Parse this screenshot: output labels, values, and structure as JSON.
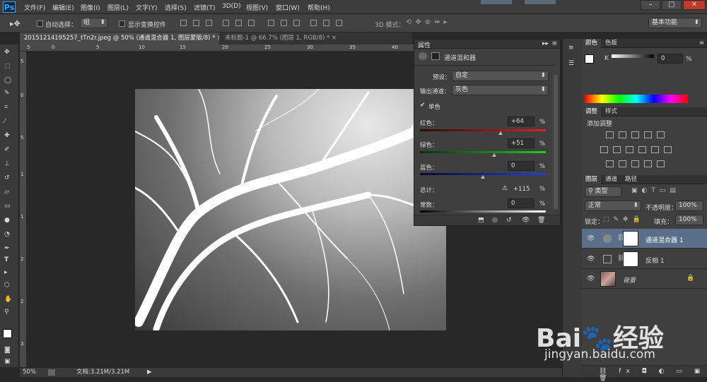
{
  "menubar": {
    "logo": "Ps",
    "items": [
      "文件(F)",
      "编辑(E)",
      "图像(I)",
      "图层(L)",
      "文字(Y)",
      "选择(S)",
      "滤镜(T)",
      "3D(D)",
      "视图(V)",
      "窗口(W)",
      "帮助(H)"
    ],
    "win_min": "–",
    "win_max": "□",
    "win_close": "✕"
  },
  "options": {
    "auto_select_label": "自动选择：",
    "auto_select_value": "组",
    "show_transform_label": "显示变换控件",
    "mode3d_label": "3D 模式：",
    "workspace": "基本功能"
  },
  "tabs": [
    {
      "label": "20151214195257_tTn2r.jpeg @ 50% (通道混合器 1, 图层蒙版/8) *",
      "close": "×"
    },
    {
      "label": "未标题-1 @ 66.7% (图层 1, RGB/8) *",
      "close": "×"
    }
  ],
  "ruler_h": [
    "5",
    "0",
    "5",
    "10",
    "15",
    "20",
    "25",
    "30",
    "35",
    "40"
  ],
  "ruler_v": [
    "5",
    "0",
    "5",
    "1",
    "1",
    "2",
    "2",
    "3"
  ],
  "status": {
    "zoom": "50%",
    "doc": "文档:3.21M/3.21M"
  },
  "properties": {
    "title": "属性",
    "panel_name": "通道混和器",
    "preset_label": "预设：",
    "preset_value": "自定",
    "output_label": "输出通道：",
    "output_value": "灰色",
    "mono_label": "单色",
    "red_label": "红色：",
    "red_value": "+64",
    "green_label": "绿色：",
    "green_value": "+51",
    "blue_label": "蓝色：",
    "blue_value": "0",
    "total_label": "总计：",
    "total_value": "+115",
    "const_label": "常数：",
    "const_value": "0",
    "percent": "%",
    "warn": "⚠",
    "red_pos": 0.64,
    "green_pos": 0.59,
    "blue_pos": 0.5
  },
  "color_panel": {
    "tabs": [
      "颜色",
      "色板"
    ],
    "label": "K",
    "value": "0",
    "percent": "%"
  },
  "adjust_panel": {
    "tabs": [
      "调整",
      "样式"
    ],
    "title": "添加调整"
  },
  "layers_panel": {
    "tabs": [
      "图层",
      "通道",
      "路径"
    ],
    "filter": "类型",
    "blend": "正常",
    "opacity_label": "不透明度：",
    "opacity": "100%",
    "lock_label": "锁定：",
    "fill_label": "填充：",
    "fill": "100%",
    "layers": [
      {
        "name": "通道混合器 1"
      },
      {
        "name": "反相 1"
      },
      {
        "name": "背景"
      }
    ],
    "bottom_icons": "⛓ fx ◘ ◐ ▭ ▣ 🗑"
  },
  "watermark": {
    "brand": "Bai🐾经验",
    "url": "jingyan.baidu.com"
  },
  "colors": {
    "accent": "#31a8ff",
    "canvas": "#9a9a9a"
  }
}
